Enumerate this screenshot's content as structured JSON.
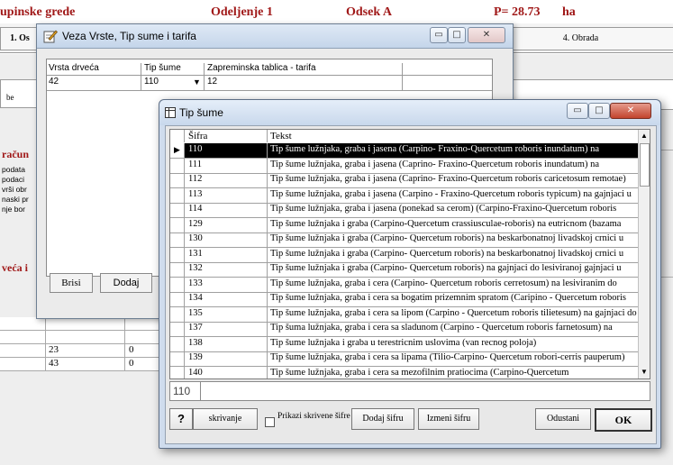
{
  "background": {
    "header_left": "upinske grede",
    "header_mid": "Odeljenje 1",
    "header_mid2": "Odsek A",
    "header_right": "P= 28.73",
    "header_unit": "ha",
    "tab1": "1. Os",
    "tab4": "4. Obrada",
    "field_label": "be",
    "racun_title": "račun",
    "racun_lines": [
      "podata",
      "podaci",
      "vrši obr",
      "naski pr",
      "nje bor"
    ],
    "veca_label": "veća i",
    "rows": [
      {
        "a": "23",
        "b": "0"
      },
      {
        "a": "43",
        "b": "0"
      }
    ]
  },
  "window1": {
    "title": "Veza Vrste, Tip sume i tarifa",
    "col1": "Vrsta drveća",
    "col2": "Tip šume",
    "col3": "Zapreminska tablica - tarifa",
    "row": {
      "c1": "42",
      "c2": "110",
      "c3": "12"
    },
    "btn_brisi": "Brisi",
    "btn_dodaj": "Dodaj"
  },
  "window2": {
    "title": "Tip šume",
    "col_code": "Šifra",
    "col_text": "Tekst",
    "rows": [
      {
        "code": "110",
        "text": "Tip šume lužnjaka, graba i jasena (Carpino- Fraxino-Quercetum roboris inundatum) na"
      },
      {
        "code": "111",
        "text": "Tip šume lužnjaka, graba i jasena (Caprino- Fraxino-Quercetum roboris inundatum) na"
      },
      {
        "code": "112",
        "text": "Tip šume lužnjaka, graba i jasena (Caprino- Fraxino-Quercetum roboris caricetosum remotae)"
      },
      {
        "code": "113",
        "text": "Tip šume lužnjaka, graba i jasena (Carpino - Fraxino-Quercetum roboris typicum) na gajnjaci u"
      },
      {
        "code": "114",
        "text": "Tip šume lužnjaka, graba i jasena (ponekad sa cerom) (Carpino-Fraxino-Quercetum roboris"
      },
      {
        "code": "129",
        "text": "Tip šume lužnjaka i graba (Carpino-Quercetum crassiusculae-roboris) na eutricnom (bazama"
      },
      {
        "code": "130",
        "text": "Tip šume lužnjaka i graba (Carpino- Quercetum roboris) na beskarbonatnoj livadskoj crnici u"
      },
      {
        "code": "131",
        "text": "Tip šume lužnjaka i graba (Carpino- Quercetum roboris) na beskarbonatnoj livadskoj crnici u"
      },
      {
        "code": "132",
        "text": "Tip šume lužnjaka i graba (Carpino- Quercetum roboris) na gajnjaci do lesiviranoj gajnjaci u"
      },
      {
        "code": "133",
        "text": "Tip šume lužnjaka, graba i cera (Carpino- Quercetum roboris cerretosum) na lesiviranim do"
      },
      {
        "code": "134",
        "text": "Tip šume lužnjaka, graba i cera sa bogatim prizemnim spratom (Caripino - Quercetum roboris"
      },
      {
        "code": "135",
        "text": "Tip šume lužnjaka, graba i cera sa lipom (Carpino - Quercetum roboris tilietesum) na gajnjaci do"
      },
      {
        "code": "137",
        "text": "Tip šuma lužnjaka, graba i cera sa sladunom (Carpino - Quercetum roboris farnetosum) na"
      },
      {
        "code": "138",
        "text": "Tip šume lužnjaka i graba u terestricnim uslovima (van recnog poloja)"
      },
      {
        "code": "139",
        "text": "Tip šume lužnjaka, graba i cera sa lipama (Tilio-Carpino- Quercetum robori-cerris pauperum)"
      },
      {
        "code": "140",
        "text": "Tip šume lužnjaka, graba i cera sa mezofilnim pratiocima (Carpino-Quercetum"
      }
    ],
    "code_value": "110",
    "help_btn": "?",
    "btn_skrivanje": "skrivanje",
    "chk_label": "Prikazi skrivene šifre",
    "btn_dodaj": "Dodaj šifru",
    "btn_izmeni": "Izmeni šifru",
    "btn_odustani": "Odustani",
    "btn_ok": "OK"
  }
}
